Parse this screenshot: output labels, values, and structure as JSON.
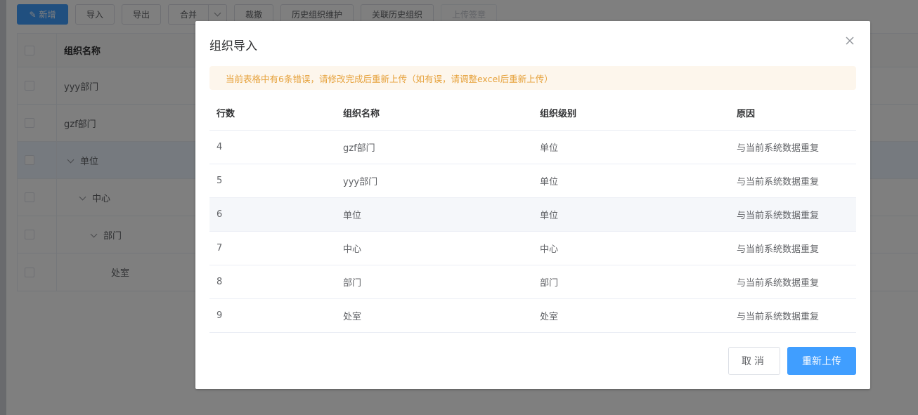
{
  "toolbar": {
    "new_label": "新增",
    "import_label": "导入",
    "export_label": "导出",
    "merge_label": "合并",
    "cut_label": "裁撤",
    "history_maint_label": "历史组织维护",
    "link_history_label": "关联历史组织",
    "upload_sign_label": "上传签章"
  },
  "background_table": {
    "header": "组织名称",
    "rows": [
      {
        "name": "yyy部门"
      },
      {
        "name": "gzf部门"
      },
      {
        "name": "单位"
      },
      {
        "name": "中心"
      },
      {
        "name": "部门"
      },
      {
        "name": "处室"
      }
    ]
  },
  "dialog": {
    "title": "组织导入",
    "alert": "当前表格中有6条错误，请修改完成后重新上传（如有误，请调整excel后重新上传）",
    "columns": [
      "行数",
      "组织名称",
      "组织级别",
      "原因"
    ],
    "rows": [
      {
        "row": "4",
        "name": "gzf部门",
        "level": "单位",
        "reason": "与当前系统数据重复"
      },
      {
        "row": "5",
        "name": "yyy部门",
        "level": "单位",
        "reason": "与当前系统数据重复"
      },
      {
        "row": "6",
        "name": "单位",
        "level": "单位",
        "reason": "与当前系统数据重复"
      },
      {
        "row": "7",
        "name": "中心",
        "level": "中心",
        "reason": "与当前系统数据重复"
      },
      {
        "row": "8",
        "name": "部门",
        "level": "部门",
        "reason": "与当前系统数据重复"
      },
      {
        "row": "9",
        "name": "处室",
        "level": "处室",
        "reason": "与当前系统数据重复"
      }
    ],
    "cancel_label": "取消",
    "reupload_label": "重新上传"
  },
  "colors": {
    "primary": "#409eff",
    "warning_text": "#e6a23c",
    "warning_bg": "#fdf6ec",
    "mask": "rgba(0,0,0,0.5)"
  },
  "icons": {
    "new_button_icon": "edit-icon",
    "close_icon": "close-icon",
    "dropdown_icon": "chevron-down-icon",
    "tree_toggle_icon": "chevron-down-icon"
  }
}
